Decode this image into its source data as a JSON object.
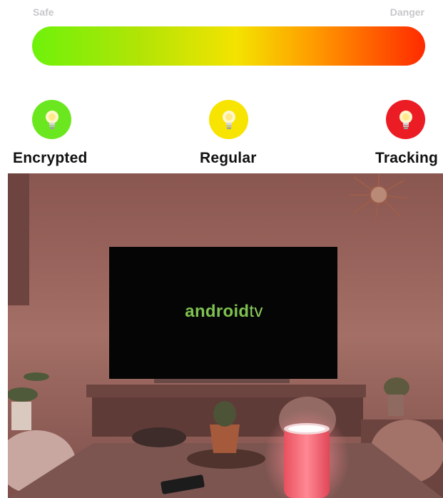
{
  "scale": {
    "safe_label": "Safe",
    "danger_label": "Danger",
    "gradient_colors": [
      "#6ef20a",
      "#f4e300",
      "#ff2a00"
    ]
  },
  "legend": [
    {
      "label": "Encrypted",
      "color": "#6be71f",
      "icon": "lightbulb-icon"
    },
    {
      "label": "Regular",
      "color": "#f7e400",
      "icon": "lightbulb-icon"
    },
    {
      "label": "Tracking",
      "color": "#ec1c24",
      "icon": "lightbulb-icon"
    }
  ],
  "scene": {
    "tv_brand": "android",
    "tv_brand_suffix": "tv",
    "speaker_color": "#ff6f7d"
  }
}
